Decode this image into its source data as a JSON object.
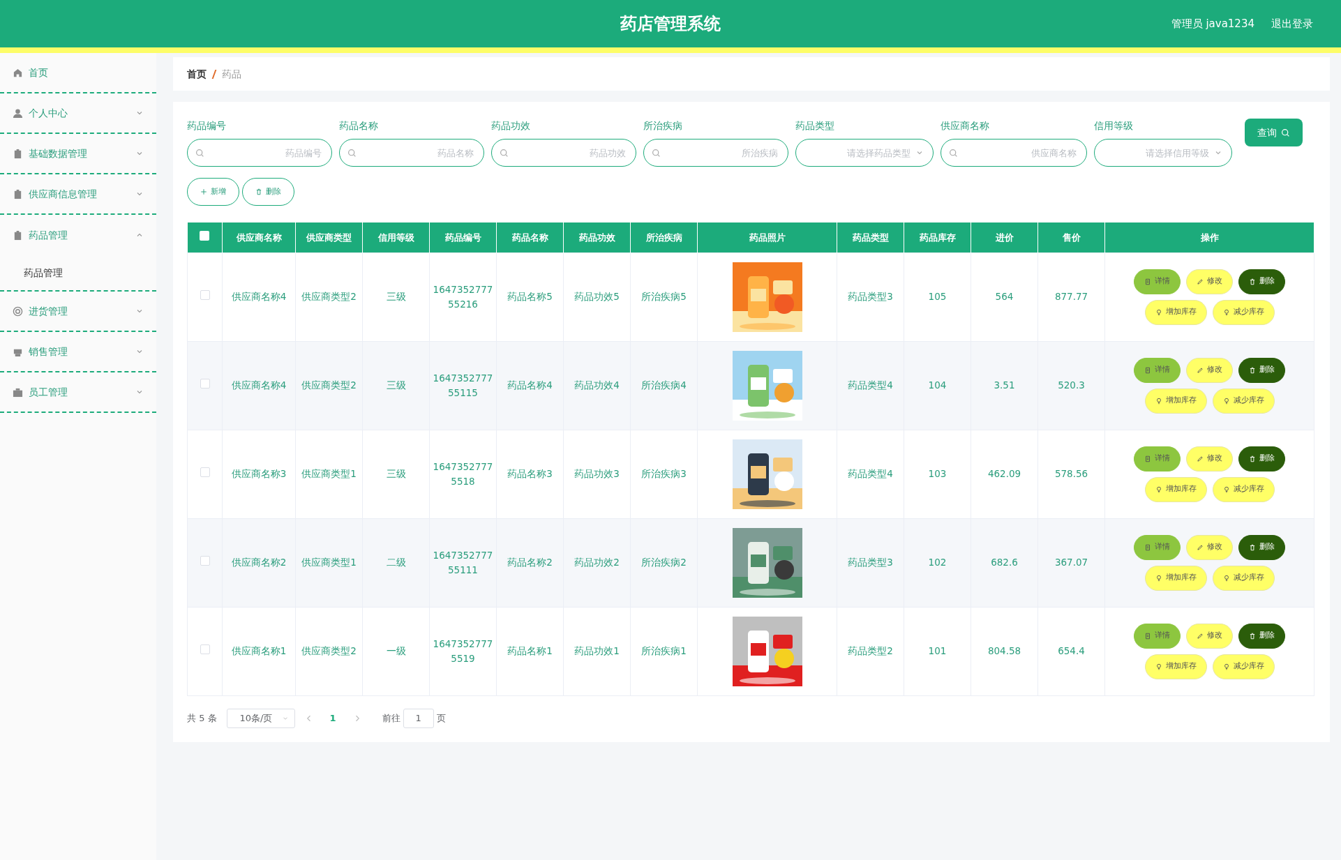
{
  "header": {
    "title": "药店管理系统",
    "user": "管理员 java1234",
    "logout": "退出登录"
  },
  "sidebar": {
    "items": [
      {
        "label": "首页"
      },
      {
        "label": "个人中心",
        "expanded": false
      },
      {
        "label": "基础数据管理",
        "expanded": false
      },
      {
        "label": "供应商信息管理",
        "expanded": false
      },
      {
        "label": "药品管理",
        "expanded": true,
        "children": [
          {
            "label": "药品管理",
            "selected": true
          }
        ]
      },
      {
        "label": "进货管理",
        "expanded": false
      },
      {
        "label": "销售管理",
        "expanded": false
      },
      {
        "label": "员工管理",
        "expanded": false
      }
    ]
  },
  "breadcrumb": [
    {
      "label": "首页"
    },
    {
      "label": "药品"
    }
  ],
  "filters": [
    {
      "label": "药品编号",
      "placeholder": "药品编号",
      "kind": "search"
    },
    {
      "label": "药品名称",
      "placeholder": "药品名称",
      "kind": "search"
    },
    {
      "label": "药品功效",
      "placeholder": "药品功效",
      "kind": "search"
    },
    {
      "label": "所治疾病",
      "placeholder": "所治疾病",
      "kind": "search"
    },
    {
      "label": "药品类型",
      "placeholder": "请选择药品类型",
      "kind": "select"
    },
    {
      "label": "供应商名称",
      "placeholder": "供应商名称",
      "kind": "search"
    },
    {
      "label": "信用等级",
      "placeholder": "请选择信用等级",
      "kind": "select"
    }
  ],
  "query_button": "查询",
  "toolbar": [
    {
      "label": "新增",
      "kind": "add"
    },
    {
      "label": "删除",
      "kind": "delete"
    }
  ],
  "table": {
    "select_all": {
      "checked": false
    },
    "columns": [
      "供应商名称",
      "供应商类型",
      "信用等级",
      "药品编号",
      "药品名称",
      "药品功效",
      "所治疾病",
      "药品照片",
      "药品类型",
      "药品库存",
      "进价",
      "售价",
      "操作"
    ],
    "rows": [
      {
        "checked": false,
        "cells": [
          "供应商名称4",
          "供应商类型2",
          "三级",
          "164735277755216",
          "药品名称5",
          "药品功效5",
          "所治疾病5",
          {
            "kind": "picture"
          },
          "药品类型3",
          "105",
          "564",
          "877.77"
        ],
        "actions": [
          "详情",
          "修改",
          "删除",
          "增加库存",
          "减少库存"
        ]
      },
      {
        "checked": false,
        "cells": [
          "供应商名称4",
          "供应商类型2",
          "三级",
          "164735277755115",
          "药品名称4",
          "药品功效4",
          "所治疾病4",
          {
            "kind": "picture"
          },
          "药品类型4",
          "104",
          "3.51",
          "520.3"
        ],
        "actions": [
          "详情",
          "修改",
          "删除",
          "增加库存",
          "减少库存"
        ]
      },
      {
        "checked": false,
        "cells": [
          "供应商名称3",
          "供应商类型1",
          "三级",
          "16473527775518",
          "药品名称3",
          "药品功效3",
          "所治疾病3",
          {
            "kind": "picture"
          },
          "药品类型4",
          "103",
          "462.09",
          "578.56"
        ],
        "actions": [
          "详情",
          "修改",
          "删除",
          "增加库存",
          "减少库存"
        ]
      },
      {
        "checked": false,
        "cells": [
          "供应商名称2",
          "供应商类型1",
          "二级",
          "164735277755111",
          "药品名称2",
          "药品功效2",
          "所治疾病2",
          {
            "kind": "picture"
          },
          "药品类型3",
          "102",
          "682.6",
          "367.07"
        ],
        "actions": [
          "详情",
          "修改",
          "删除",
          "增加库存",
          "减少库存"
        ]
      },
      {
        "checked": false,
        "cells": [
          "供应商名称1",
          "供应商类型2",
          "一级",
          "16473527775519",
          "药品名称1",
          "药品功效1",
          "所治疾病1",
          {
            "kind": "picture"
          },
          "药品类型2",
          "101",
          "804.58",
          "654.4"
        ],
        "actions": [
          "详情",
          "修改",
          "删除",
          "增加库存",
          "减少库存"
        ]
      }
    ]
  },
  "pagination": {
    "total": "共 5 条",
    "page_size": "10条/页",
    "pages": [
      {
        "label": "1",
        "selected": true
      }
    ],
    "goto_label": "前往",
    "goto_value": "1",
    "goto_suffix": "页"
  }
}
